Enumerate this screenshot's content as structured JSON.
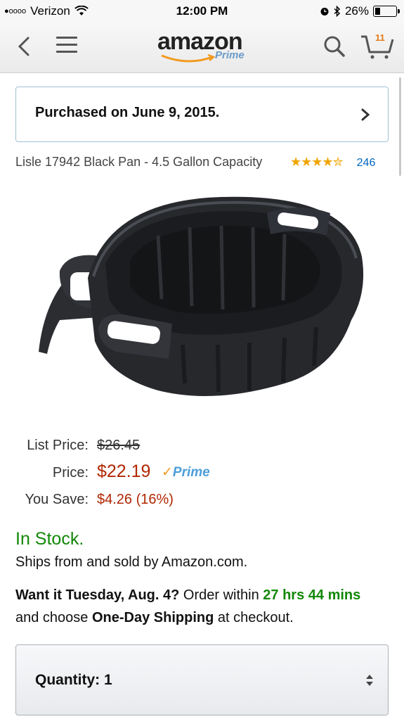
{
  "status_bar": {
    "signal": "●oooo",
    "carrier": "Verizon",
    "time": "12:00 PM",
    "battery": "26%",
    "battery_level": 0.26
  },
  "nav": {
    "logo_word": "amazon",
    "logo_prime": "Prime",
    "cart_count": "11"
  },
  "purchase_notice": {
    "text": "Purchased on June 9, 2015."
  },
  "product": {
    "title": "Lisle 17942 Black Pan - 4.5 Gallon Capacity",
    "stars": "★★★★✮",
    "rating_value": 4.5,
    "rating_count": "246"
  },
  "pricing": {
    "list_price_label": "List Price:",
    "list_price": "$26.45",
    "price_label": "Price:",
    "price": "$22.19",
    "prime_check": "✓",
    "prime_word": "Prime",
    "you_save_label": "You Save:",
    "you_save": "$4.26 (16%)"
  },
  "availability": {
    "stock": "In Stock.",
    "ships_from": "Ships from and sold by Amazon.com.",
    "want_it": "Want it Tuesday, Aug. 4?",
    "order_within": " Order within ",
    "countdown": "27 hrs 44 mins",
    "and_choose": " and choose ",
    "shipping_option": "One-Day Shipping",
    "at_checkout": " at checkout."
  },
  "quantity": {
    "label": "Quantity: 1"
  },
  "colors": {
    "price_red": "#b12704",
    "stock_green": "#138808",
    "link_blue": "#0066c0",
    "star_gold": "#f0a500",
    "prime_blue": "#4c9ed9"
  }
}
